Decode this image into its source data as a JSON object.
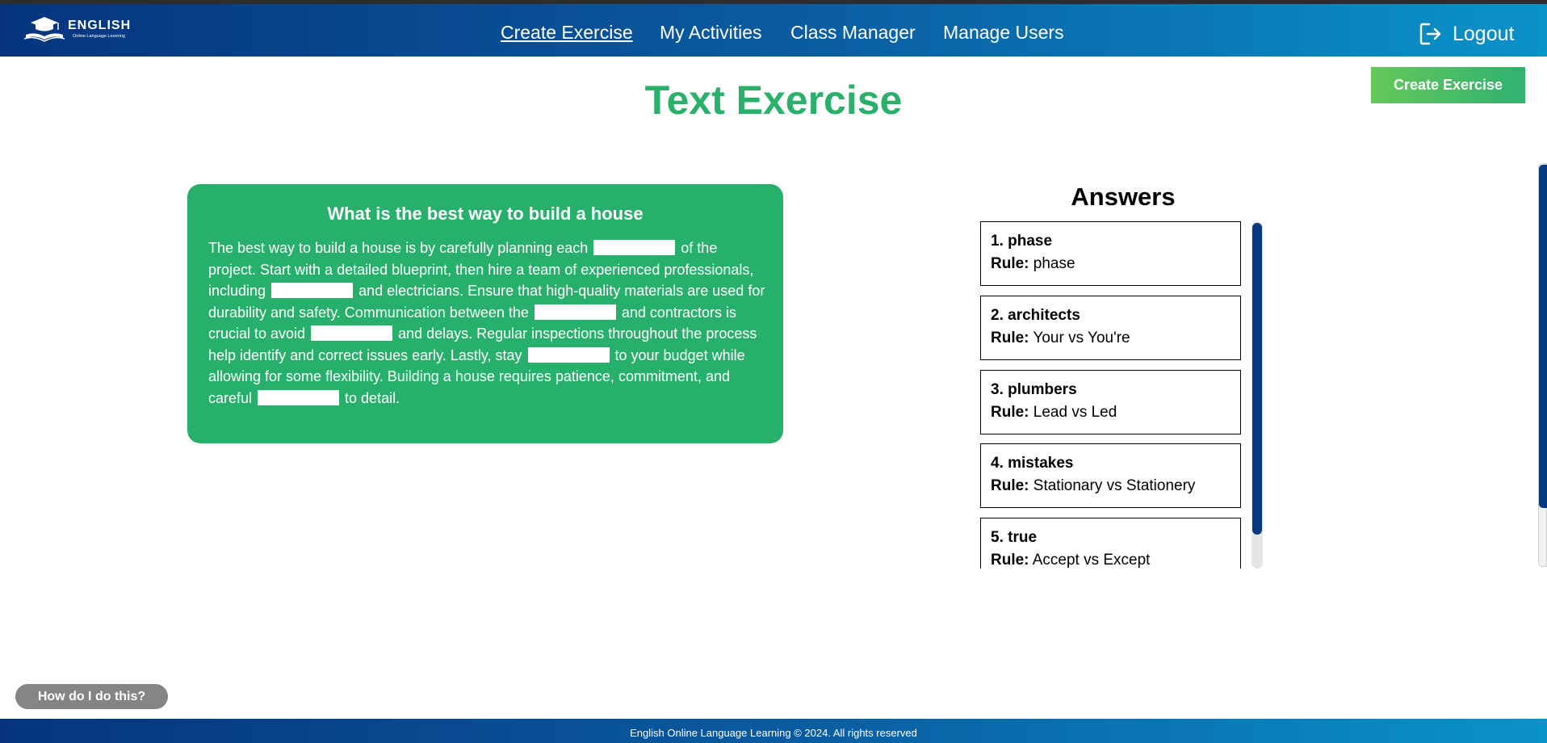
{
  "brand": {
    "title": "ENGLISH",
    "subtitle": "Online Language Learning",
    "icon": "graduation-cap-book-icon"
  },
  "nav": {
    "links": [
      {
        "label": "Create Exercise",
        "active": true
      },
      {
        "label": "My Activities",
        "active": false
      },
      {
        "label": "Class Manager",
        "active": false
      },
      {
        "label": "Manage Users",
        "active": false
      }
    ],
    "logout_label": "Logout",
    "logout_icon": "logout-icon"
  },
  "page": {
    "title": "Text Exercise",
    "create_button": "Create Exercise"
  },
  "exercise": {
    "title": "What is the best way to build a house",
    "segments": [
      "The best way to build a house is by carefully planning each",
      "of the project. Start with a detailed blueprint, then hire a team of experienced professionals, including",
      "and electricians. Ensure that high-quality materials are used for durability and safety. Communication between the",
      "and contractors is crucial to avoid",
      "and delays. Regular inspections throughout the process help identify and correct issues early. Lastly, stay",
      "to your budget while allowing for some flexibility. Building a house requires patience, commitment, and careful",
      "to detail."
    ],
    "blank_count": 6
  },
  "answers": {
    "title": "Answers",
    "rule_label": "Rule:",
    "items": [
      {
        "word": "1. phase",
        "rule": "phase"
      },
      {
        "word": "2. architects",
        "rule": "Your vs You're"
      },
      {
        "word": "3. plumbers",
        "rule": "Lead vs Led"
      },
      {
        "word": "4. mistakes",
        "rule": "Stationary vs Stationery"
      },
      {
        "word": "5. true",
        "rule": "Accept vs Except"
      }
    ]
  },
  "help_button": "How do I do this?",
  "footer": "English Online Language Learning © 2024. All rights reserved",
  "colors": {
    "nav_start": "#05347d",
    "nav_end": "#0a93c9",
    "accent_green": "#27b06c",
    "title_green": "#2ab06b",
    "scrollbar": "#06397f",
    "help_gray": "#848484"
  }
}
